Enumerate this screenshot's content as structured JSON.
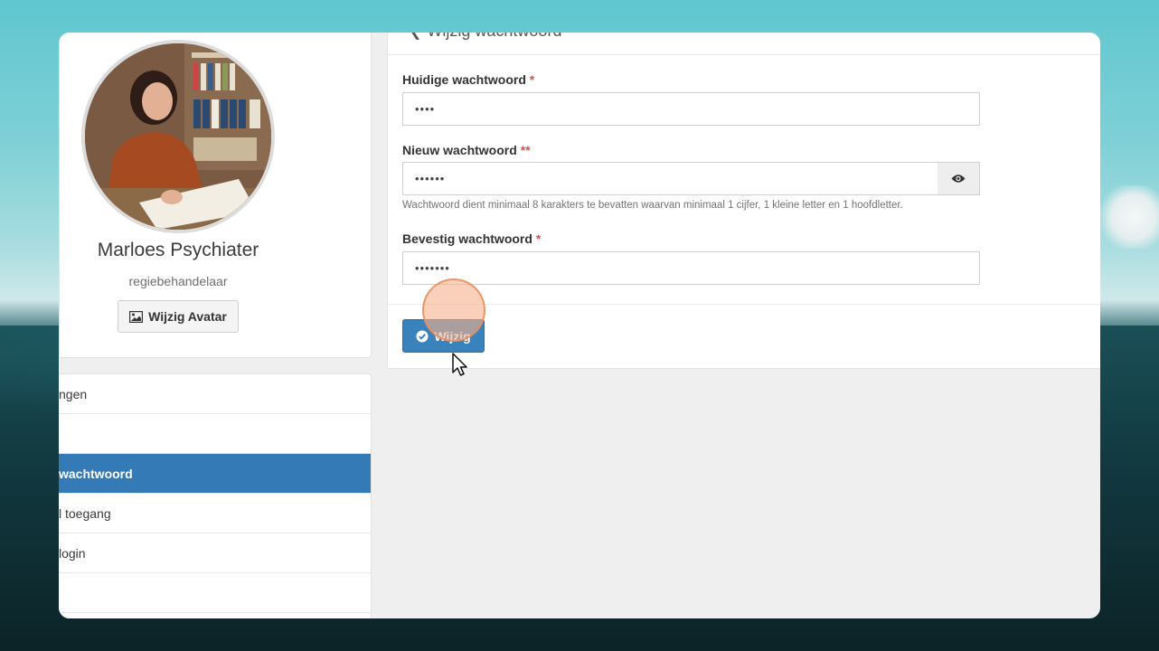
{
  "profile": {
    "name": "Marloes Psychiater",
    "role": "regiebehandelaar",
    "avatar_button": "Wijzig Avatar"
  },
  "menu": {
    "items": [
      {
        "label": "ngen",
        "active": false
      },
      {
        "label": "",
        "active": false
      },
      {
        "label": "wachtwoord",
        "active": true
      },
      {
        "label": "l toegang",
        "active": false
      },
      {
        "label": "login",
        "active": false
      },
      {
        "label": "",
        "active": false
      }
    ]
  },
  "panel": {
    "title": "Wijzig wachtwoord",
    "fields": {
      "current": {
        "label": "Huidige wachtwoord",
        "required": "*",
        "value": "••••"
      },
      "new": {
        "label": "Nieuw wachtwoord",
        "required": "**",
        "value": "••••••"
      },
      "confirm": {
        "label": "Bevestig wachtwoord",
        "required": "*",
        "value": "•••••••"
      }
    },
    "help_text": "Wachtwoord dient minimaal 8 karakters te bevatten waarvan minimaal 1 cijfer, 1 kleine letter en 1 hoofdletter.",
    "submit_label": "Wijzig"
  },
  "colors": {
    "primary": "#337ab7",
    "required": "#d9534f",
    "click_highlight": "#f6b08c"
  }
}
